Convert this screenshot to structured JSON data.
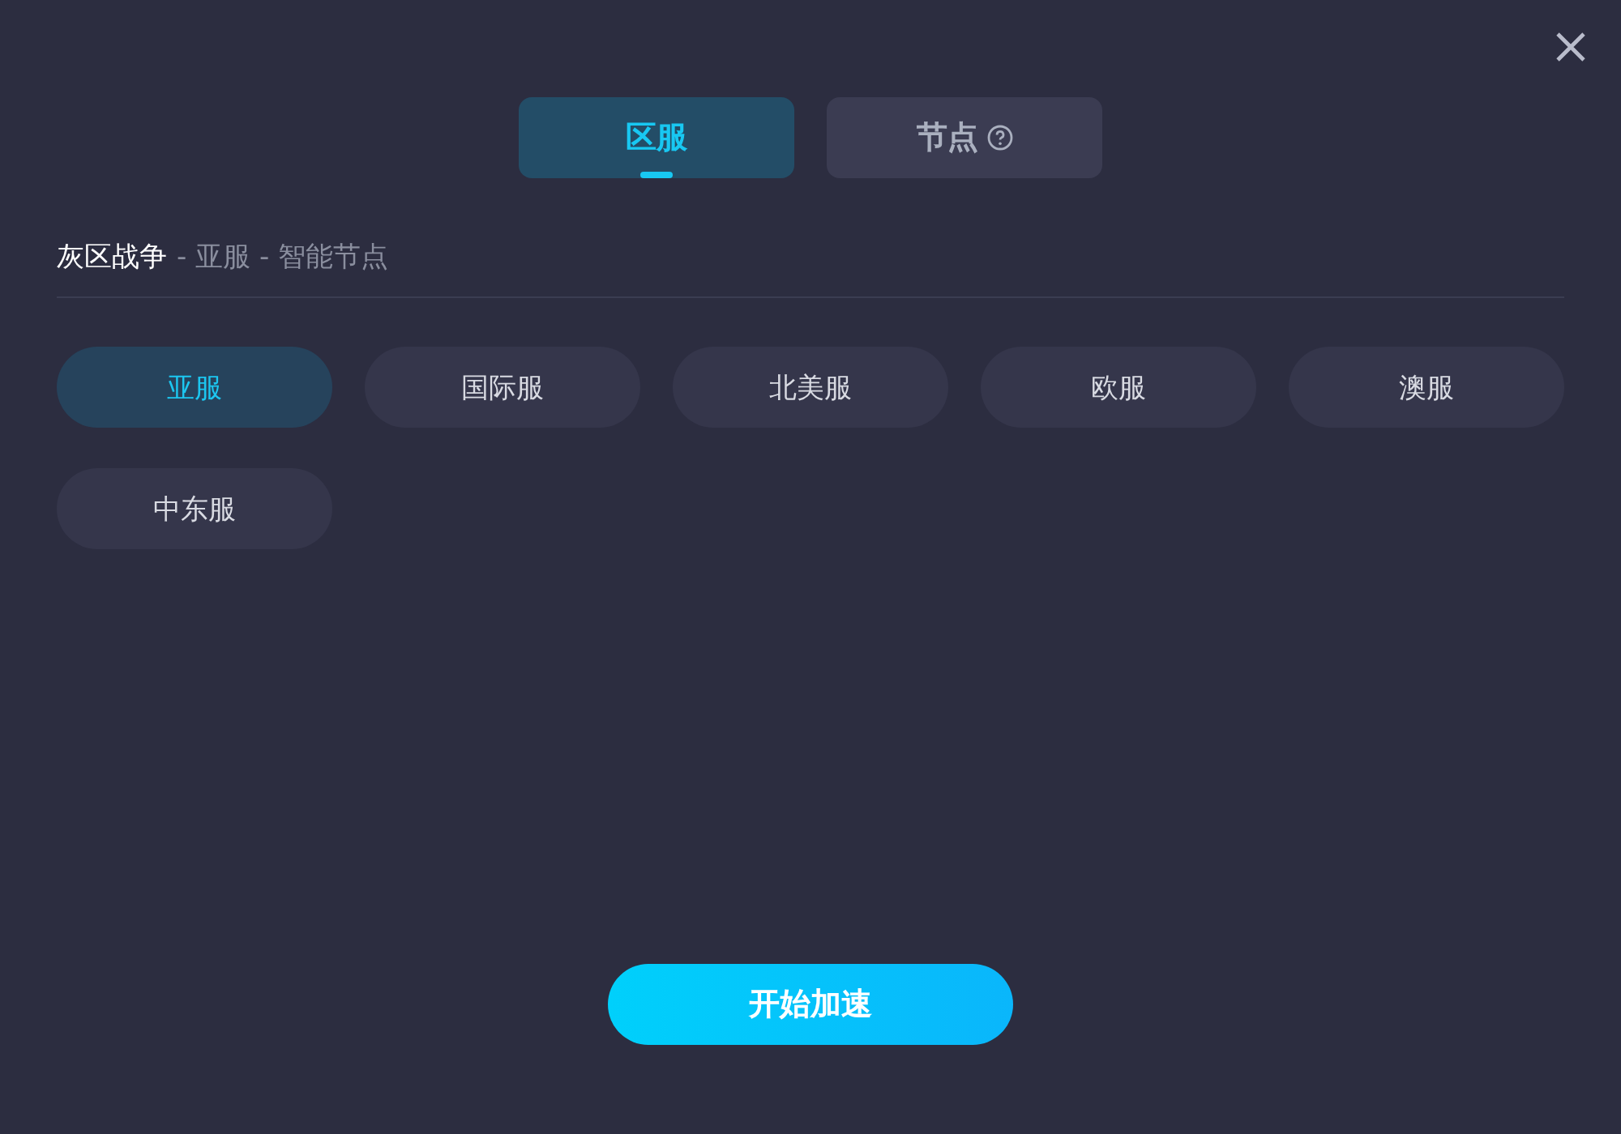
{
  "tabs": [
    {
      "label": "区服",
      "selected": true,
      "help": false
    },
    {
      "label": "节点",
      "selected": false,
      "help": true
    }
  ],
  "breadcrumb": {
    "game": "灰区战争",
    "path": "- 亚服 - 智能节点"
  },
  "regions": [
    {
      "label": "亚服",
      "selected": true
    },
    {
      "label": "国际服",
      "selected": false
    },
    {
      "label": "北美服",
      "selected": false
    },
    {
      "label": "欧服",
      "selected": false
    },
    {
      "label": "澳服",
      "selected": false
    },
    {
      "label": "中东服",
      "selected": false
    }
  ],
  "start_button": "开始加速"
}
